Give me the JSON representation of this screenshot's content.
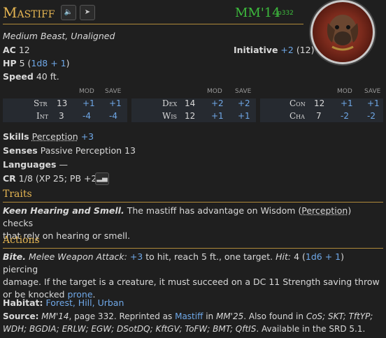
{
  "header": {
    "name": "Mastiff",
    "source_abbr": "MM'14",
    "source_page": "p332",
    "size_type": "Medium Beast, Unaligned"
  },
  "colors": {
    "accent": "#e5b552",
    "link": "#6fa8e8",
    "source": "#3dbb3d"
  },
  "basic": {
    "ac_label": "AC",
    "ac_value": "12",
    "hp_label": "HP",
    "hp_value": "5 (",
    "hp_dice": "1d8 + 1",
    "hp_close": ")",
    "speed_label": "Speed",
    "speed_value": "40 ft.",
    "init_label": "Initiative",
    "init_mod": "+2",
    "init_score": "(12)"
  },
  "abilities": {
    "mod_header": "MOD",
    "save_header": "SAVE",
    "rows": [
      {
        "name": "Str",
        "score": "13",
        "mod": "+1",
        "save": "+1"
      },
      {
        "name": "Int",
        "score": "3",
        "mod": "-4",
        "save": "-4"
      },
      {
        "name": "Dex",
        "score": "14",
        "mod": "+2",
        "save": "+2"
      },
      {
        "name": "Wis",
        "score": "12",
        "mod": "+1",
        "save": "+1"
      },
      {
        "name": "Con",
        "score": "12",
        "mod": "+1",
        "save": "+1"
      },
      {
        "name": "Cha",
        "score": "7",
        "mod": "-2",
        "save": "-2"
      }
    ]
  },
  "details": {
    "skills_label": "Skills",
    "skills_name": "Perception",
    "skills_mod": "+3",
    "senses_label": "Senses",
    "senses_value": "Passive Perception 13",
    "languages_label": "Languages",
    "languages_value": "—",
    "cr_label": "CR",
    "cr_value": "1/8 (XP 25; PB +2)"
  },
  "traits": {
    "title": "Traits",
    "name": "Keen Hearing and Smell.",
    "text1": "The mastiff has advantage on Wisdom (",
    "link": "Perception",
    "text2": ") checks",
    "text3": "that rely on hearing or smell."
  },
  "actions": {
    "title": "Actions",
    "name": "Bite.",
    "type": "Melee Weapon Attack:",
    "tohit": "+3",
    "text1": "to hit, reach 5 ft., one target.",
    "hit_label": "Hit:",
    "hit_value": "4 (",
    "hit_dice": "1d6 + 1",
    "hit_close": ") piercing",
    "line2": "damage. If the target is a creature, it must succeed on a DC 11 Strength saving throw",
    "line3_pre": "or be knocked",
    "line3_link": "prone",
    "line3_post": "."
  },
  "footer": {
    "habitat_label": "Habitat:",
    "habitat_values": "Forest, Hill, Urban",
    "source_label": "Source:",
    "src_a": "MM'14",
    "src_b": ", page 332. Reprinted as",
    "src_link": "Mastiff",
    "src_c": "in",
    "src_d": "MM'25",
    "src_e": ". Also found in",
    "src_f": "CoS; SKT; TftYP;",
    "line2_ital": "WDH; BGDIA; ERLW; EGW; DSotDQ; KftGV; ToFW; BMT; QftIS",
    "line2_end": ". Available in the SRD 5.1."
  }
}
